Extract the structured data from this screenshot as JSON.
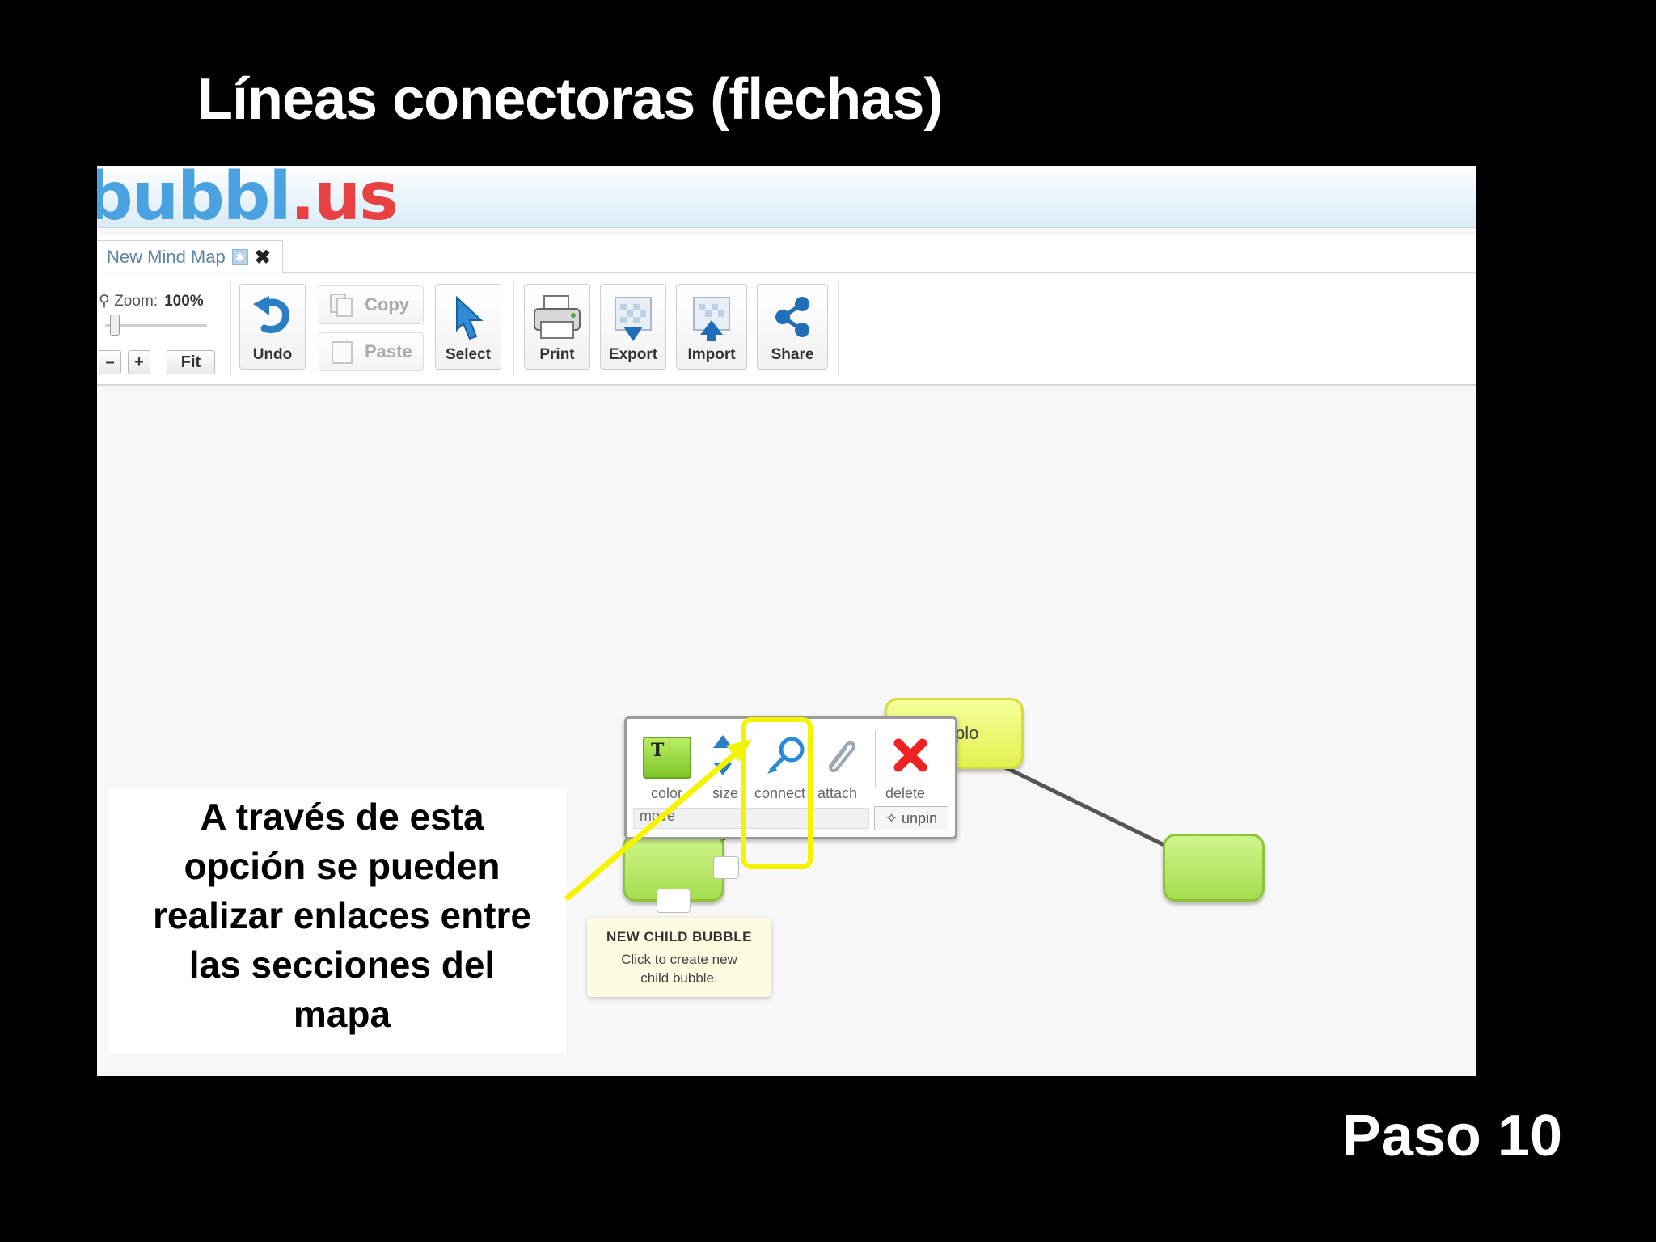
{
  "slide": {
    "title": "Líneas conectoras (flechas)",
    "step": "Paso 10"
  },
  "app": {
    "logo": {
      "part1": "bubbl",
      "dot": ".",
      "part2": "us"
    },
    "tab": {
      "label": "New Mind Map",
      "close": "✖"
    },
    "toolbar": {
      "zoom_label": "Zoom:",
      "zoom_value": "100%",
      "zoom_minus": "–",
      "zoom_plus": "+",
      "fit": "Fit",
      "undo": "Undo",
      "copy": "Copy",
      "paste": "Paste",
      "select": "Select",
      "print": "Print",
      "export": "Export",
      "import": "Import",
      "share": "Share"
    },
    "popup": {
      "color": "color",
      "size": "size",
      "connect": "connect",
      "attach": "attach",
      "delete": "delete",
      "move": "move",
      "unpin": "unpin"
    },
    "bubbles": {
      "root_text": "plo"
    },
    "tooltip": {
      "title": "NEW CHILD BUBBLE",
      "line1": "Click to create new",
      "line2": "child bubble."
    }
  },
  "annotation": {
    "line1": "A través de esta",
    "line2": "opción se pueden",
    "line3": "realizar enlaces entre",
    "line4": "las secciones del",
    "line5": "mapa"
  },
  "colors": {
    "highlight": "#f4f400",
    "bubble_green": "#a6dc4e",
    "bubble_yellow": "#e3f04f",
    "logo_blue": "#4aa3e0",
    "logo_red": "#e84141"
  }
}
